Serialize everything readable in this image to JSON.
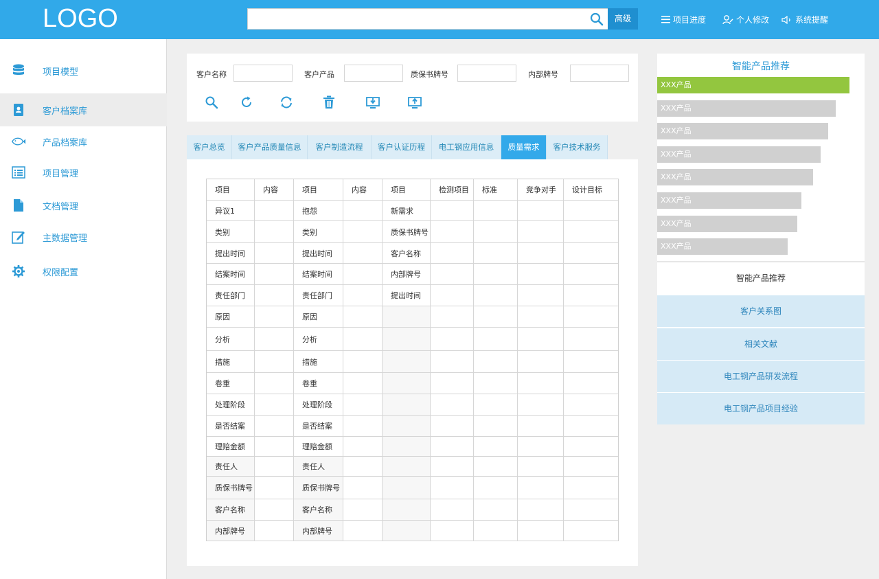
{
  "header": {
    "logo": "LOGO",
    "search": {
      "value": "",
      "advanced_label": "高级"
    },
    "nav": [
      {
        "label": "项目进度",
        "icon": "menu-lines-icon"
      },
      {
        "label": "个人修改",
        "icon": "user-edit-icon"
      },
      {
        "label": "系统提醒",
        "icon": "speaker-icon"
      }
    ]
  },
  "sidebar": {
    "items": [
      {
        "label": "项目模型",
        "icon": "database-icon"
      },
      {
        "label": "客户档案库",
        "icon": "contact-book-icon",
        "active": true
      },
      {
        "label": "产品档案库",
        "icon": "fish-icon"
      },
      {
        "label": "项目管理",
        "icon": "list-icon"
      },
      {
        "label": "文档管理",
        "icon": "document-icon"
      },
      {
        "label": "主数据管理",
        "icon": "edit-icon"
      },
      {
        "label": "权限配置",
        "icon": "gear-icon"
      }
    ]
  },
  "filter": {
    "fields": [
      {
        "label": "客户名称",
        "value": ""
      },
      {
        "label": "客户产品",
        "value": ""
      },
      {
        "label": "质保书牌号",
        "value": ""
      },
      {
        "label": "内部牌号",
        "value": ""
      }
    ],
    "tools": [
      "search-icon",
      "refresh-icon",
      "sync-icon",
      "trash-icon",
      "download-icon",
      "upload-icon"
    ]
  },
  "tabs": [
    {
      "label": "客户总览"
    },
    {
      "label": "客户产品质量信息"
    },
    {
      "label": "客户制造流程"
    },
    {
      "label": "客户认证历程"
    },
    {
      "label": "电工钢应用信息"
    },
    {
      "label": "质量需求",
      "active": true
    },
    {
      "label": "客户技术服务"
    }
  ],
  "table": {
    "headers": [
      "项目",
      "内容",
      "项目",
      "内容",
      "项目",
      "检测项目",
      "标准",
      "竞争对手",
      "设计目标"
    ],
    "rows": [
      [
        "异议1",
        "",
        "抱怨",
        "",
        "新需求",
        "",
        "",
        "",
        ""
      ],
      [
        "类别",
        "",
        "类别",
        "",
        "质保书牌号",
        "",
        "",
        "",
        ""
      ],
      [
        "提出时间",
        "",
        "提出时间",
        "",
        "客户名称",
        "",
        "",
        "",
        ""
      ],
      [
        "结案时间",
        "",
        "结案时间",
        "",
        "内部牌号",
        "",
        "",
        "",
        ""
      ],
      [
        "责任部门",
        "",
        "责任部门",
        "",
        "提出时间",
        "",
        "",
        "",
        ""
      ],
      [
        "原因",
        "",
        "原因",
        "",
        "",
        "",
        "",
        "",
        ""
      ],
      [
        "分析",
        "",
        "分析",
        "",
        "",
        "",
        "",
        "",
        ""
      ],
      [
        "措施",
        "",
        "措施",
        "",
        "",
        "",
        "",
        "",
        ""
      ],
      [
        "卷重",
        "",
        "卷重",
        "",
        "",
        "",
        "",
        "",
        ""
      ],
      [
        "处理阶段",
        "",
        "处理阶段",
        "",
        "",
        "",
        "",
        "",
        ""
      ],
      [
        "是否结案",
        "",
        "是否结案",
        "",
        "",
        "",
        "",
        "",
        ""
      ],
      [
        "理赔金额",
        "",
        "理赔金额",
        "",
        "",
        "",
        "",
        "",
        ""
      ],
      [
        "责任人",
        "",
        "责任人",
        "",
        "",
        "",
        "",
        "",
        ""
      ],
      [
        "质保书牌号",
        "",
        "质保书牌号",
        "",
        "",
        "",
        "",
        "",
        ""
      ],
      [
        "客户名称",
        "",
        "客户名称",
        "",
        "",
        "",
        "",
        "",
        ""
      ],
      [
        "内部牌号",
        "",
        "内部牌号",
        "",
        "",
        "",
        "",
        "",
        ""
      ]
    ]
  },
  "recommend": {
    "title": "智能产品推荐",
    "bars": [
      {
        "label": "XXX产品",
        "value": 1.0
      },
      {
        "label": "XXX产品",
        "value": 0.93
      },
      {
        "label": "XXX产品",
        "value": 0.89
      },
      {
        "label": "XXX产品",
        "value": 0.85
      },
      {
        "label": "XXX产品",
        "value": 0.81
      },
      {
        "label": "XXX产品",
        "value": 0.75
      },
      {
        "label": "XXX产品",
        "value": 0.73
      },
      {
        "label": "XXX产品",
        "value": 0.68
      }
    ],
    "links": [
      {
        "label": "智能产品推荐",
        "style": "plain"
      },
      {
        "label": "客户关系图",
        "style": "blue"
      },
      {
        "label": "相关文献",
        "style": "blue"
      },
      {
        "label": "电工钢产品研发流程",
        "style": "blue"
      },
      {
        "label": "电工钢产品项目经验",
        "style": "blue"
      }
    ]
  },
  "colors": {
    "header_bg": "#31a9e9",
    "accent": "#2d9ad6",
    "active_tab": "#33a9ea",
    "bar_primary": "#93c63f",
    "bar_secondary": "#d0d0d0"
  }
}
